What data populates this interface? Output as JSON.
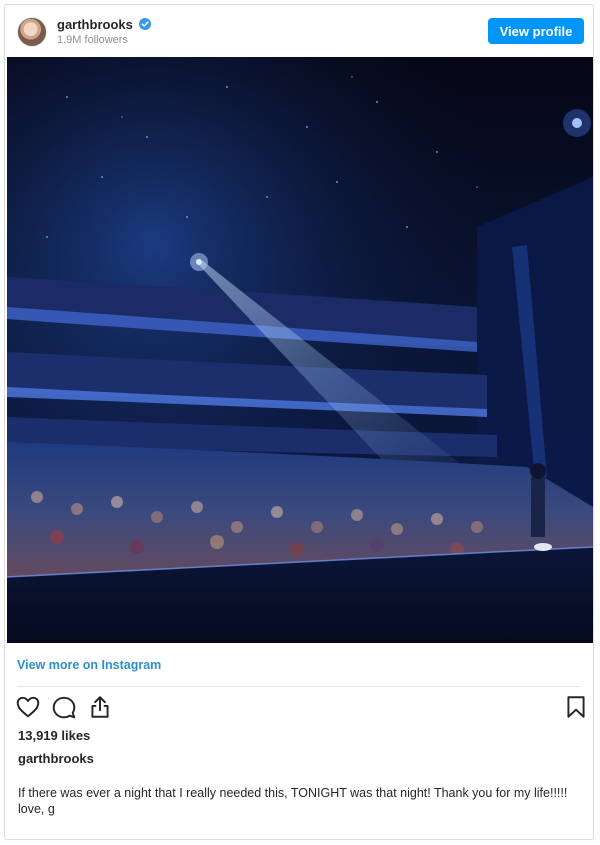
{
  "post": {
    "username": "garthbrooks",
    "followers": "1.9M followers",
    "view_profile_label": "View profile",
    "view_more_label": "View more on Instagram",
    "likes": "13,919 likes",
    "caption_user": "garthbrooks",
    "caption_line1": "If there was ever a night that I really needed this, TONIGHT was that night! Thank you for my life!!!!!",
    "caption_line2": "love, g"
  },
  "icons": {
    "verified": "verified-badge-icon",
    "like": "heart-icon",
    "comment": "comment-bubble-icon",
    "share": "share-icon",
    "save": "bookmark-icon"
  },
  "colors": {
    "accent": "#0095f6",
    "link": "#2e8fcb"
  }
}
